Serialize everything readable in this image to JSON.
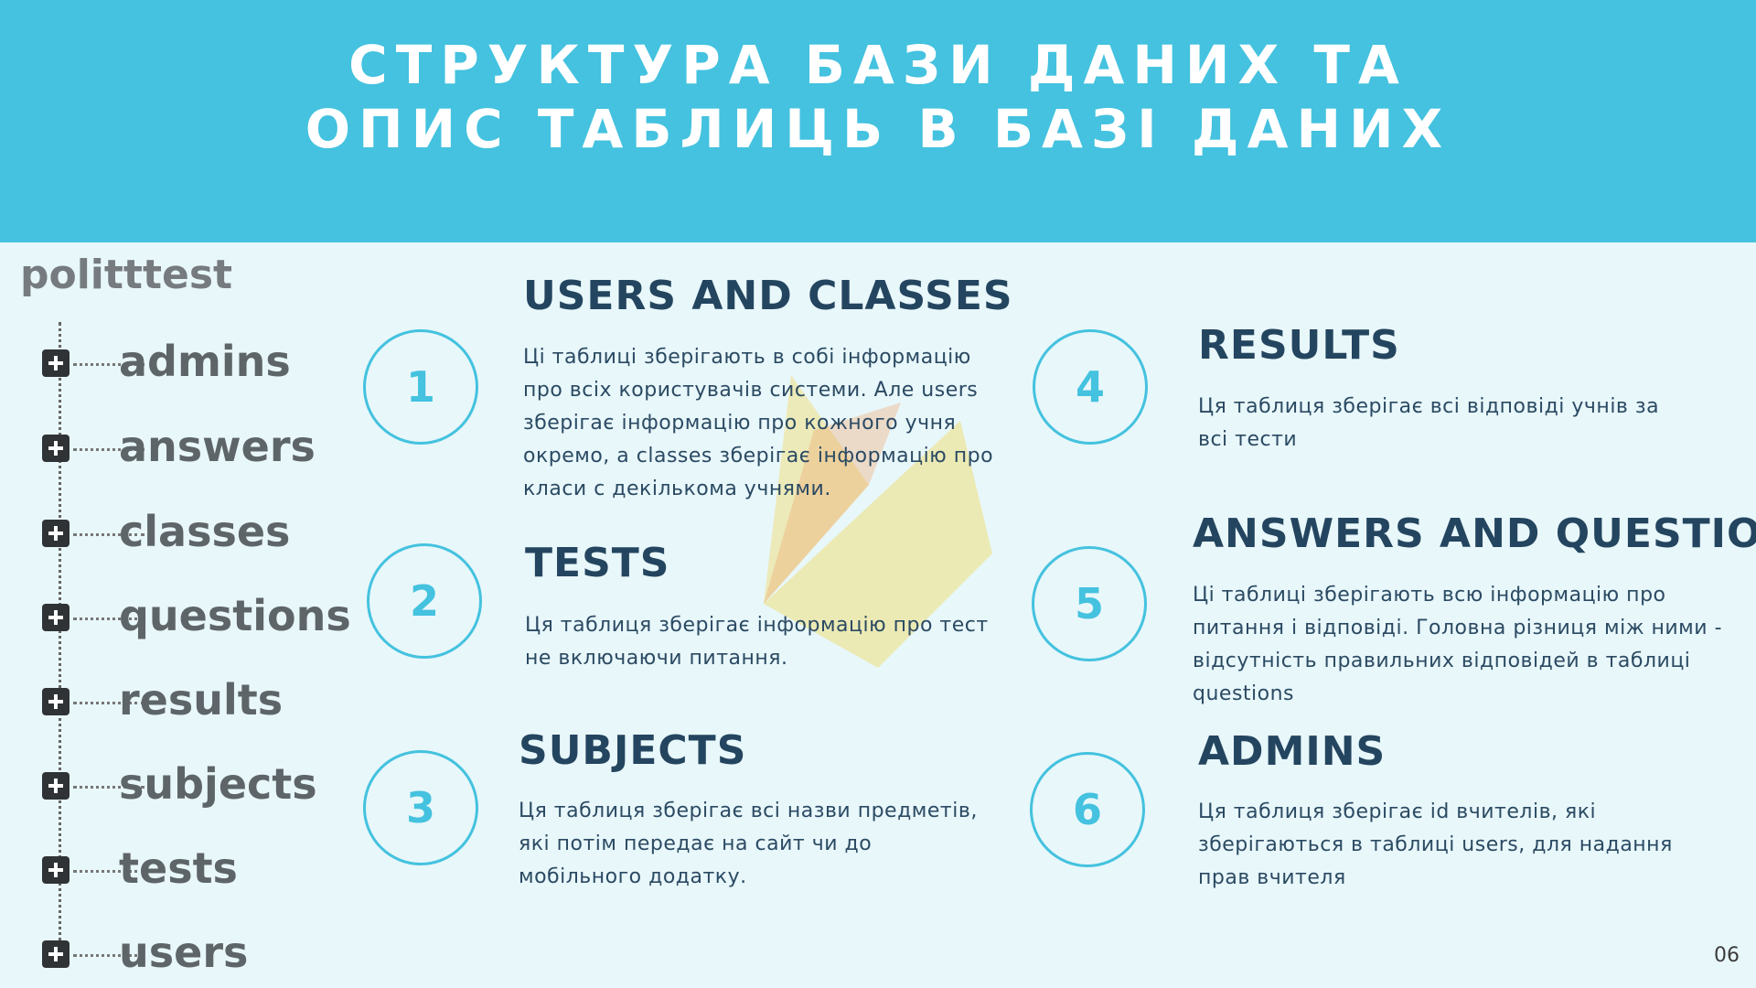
{
  "header": {
    "line1": "СТРУКТУРА БАЗИ ДАНИХ ТА",
    "line2": "ОПИС ТАБЛИЦЬ В БАЗІ ДАНИХ"
  },
  "database": {
    "name": "politttest",
    "tables": [
      "admins",
      "answers",
      "classes",
      "questions",
      "results",
      "subjects",
      "tests",
      "users"
    ]
  },
  "sections": [
    {
      "number": "1",
      "title": "USERS AND CLASSES",
      "text": "Ці таблиці зберігають в собі інформацію про всіх користувачів системи. Але users зберігає інформацію про кожного учня окремо, а classes зберігає інформацію про класи с декількома учнями."
    },
    {
      "number": "2",
      "title": "TESTS",
      "text": "Ця таблиця зберігає інформацію про тест не включаючи питання."
    },
    {
      "number": "3",
      "title": "SUBJECTS",
      "text": "Ця таблиця зберігає всі назви предметів, які потім передає на сайт чи до мобільного додатку."
    },
    {
      "number": "4",
      "title": "RESULTS",
      "text": "Ця таблиця зберігає всі відповіді учнів за всі тести"
    },
    {
      "number": "5",
      "title": "ANSWERS AND QUESTIONS",
      "text": "Ці таблиці зберігають всю інформацію про питання і відповіді. Головна різниця між ними - відсутність правильних відповідей в таблиці questions"
    },
    {
      "number": "6",
      "title": "ADMINS",
      "text": "Ця таблиця зберігає id вчителів, які зберігаються в таблиці users, для надання прав вчителя"
    }
  ],
  "page_number": "06",
  "colors": {
    "accent": "#44c2df",
    "title": "#24455f",
    "background": "#e8f7fa"
  }
}
